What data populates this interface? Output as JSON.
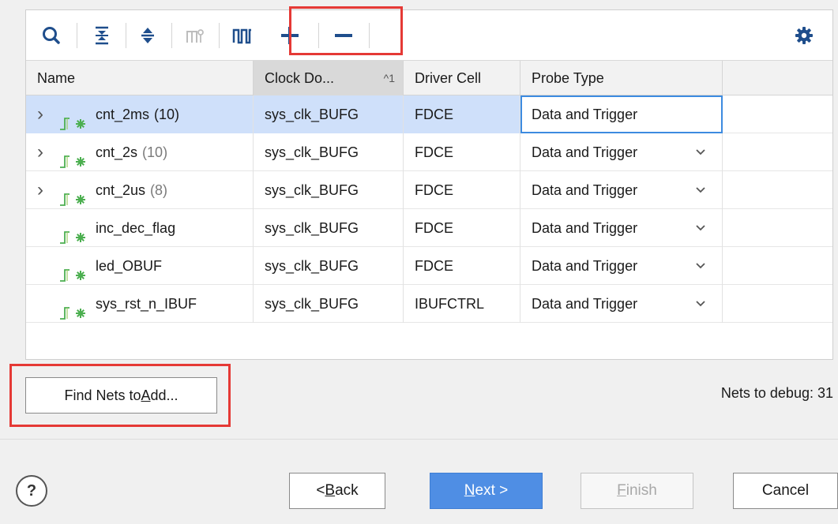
{
  "toolbar": {
    "icons": [
      {
        "name": "search-icon",
        "enabled": true
      },
      {
        "name": "collapse-all-icon",
        "enabled": true
      },
      {
        "name": "expand-all-icon",
        "enabled": true
      },
      {
        "name": "group-icon",
        "enabled": false
      },
      {
        "name": "waveform-icon",
        "enabled": true
      },
      {
        "name": "add-icon",
        "enabled": true
      },
      {
        "name": "remove-icon",
        "enabled": true
      },
      {
        "name": "gear-icon",
        "enabled": true
      }
    ]
  },
  "table": {
    "columns": [
      {
        "label": "Name"
      },
      {
        "label": "Clock Do...",
        "sort_indicator": "^1"
      },
      {
        "label": "Driver Cell"
      },
      {
        "label": "Probe Type"
      }
    ],
    "rows": [
      {
        "expandable": true,
        "name": "cnt_2ms",
        "count": "(10)",
        "clock": "sys_clk_BUFG",
        "driver": "FDCE",
        "probe": "Data and Trigger",
        "selected": true,
        "editing": true
      },
      {
        "expandable": true,
        "name": "cnt_2s",
        "count": "(10)",
        "clock": "sys_clk_BUFG",
        "driver": "FDCE",
        "probe": "Data and Trigger",
        "selected": false,
        "editing": false
      },
      {
        "expandable": true,
        "name": "cnt_2us",
        "count": "(8)",
        "clock": "sys_clk_BUFG",
        "driver": "FDCE",
        "probe": "Data and Trigger",
        "selected": false,
        "editing": false
      },
      {
        "expandable": false,
        "name": "inc_dec_flag",
        "count": "",
        "clock": "sys_clk_BUFG",
        "driver": "FDCE",
        "probe": "Data and Trigger",
        "selected": false,
        "editing": false
      },
      {
        "expandable": false,
        "name": "led_OBUF",
        "count": "",
        "clock": "sys_clk_BUFG",
        "driver": "FDCE",
        "probe": "Data and Trigger",
        "selected": false,
        "editing": false
      },
      {
        "expandable": false,
        "name": "sys_rst_n_IBUF",
        "count": "",
        "clock": "sys_clk_BUFG",
        "driver": "IBUFCTRL",
        "probe": "Data and Trigger",
        "selected": false,
        "editing": false
      }
    ]
  },
  "find_button": {
    "prefix": "Find Nets to ",
    "mnemonic": "A",
    "suffix": "dd..."
  },
  "nets_to_debug": "Nets to debug: 31",
  "help": {
    "label": "?"
  },
  "buttons": {
    "back": {
      "prefix": "< ",
      "mnemonic": "B",
      "suffix": "ack"
    },
    "next": {
      "prefix": "",
      "mnemonic": "N",
      "suffix": "ext >"
    },
    "finish": {
      "prefix": "",
      "mnemonic": "F",
      "suffix": "inish"
    },
    "cancel": {
      "label": "Cancel"
    }
  },
  "colors": {
    "highlight": "#e53935",
    "selection": "#cfe0fa",
    "primary_button": "#4f8ee4",
    "net_icon_green": "#4caf50",
    "icon_blue": "#1f4e8c"
  }
}
